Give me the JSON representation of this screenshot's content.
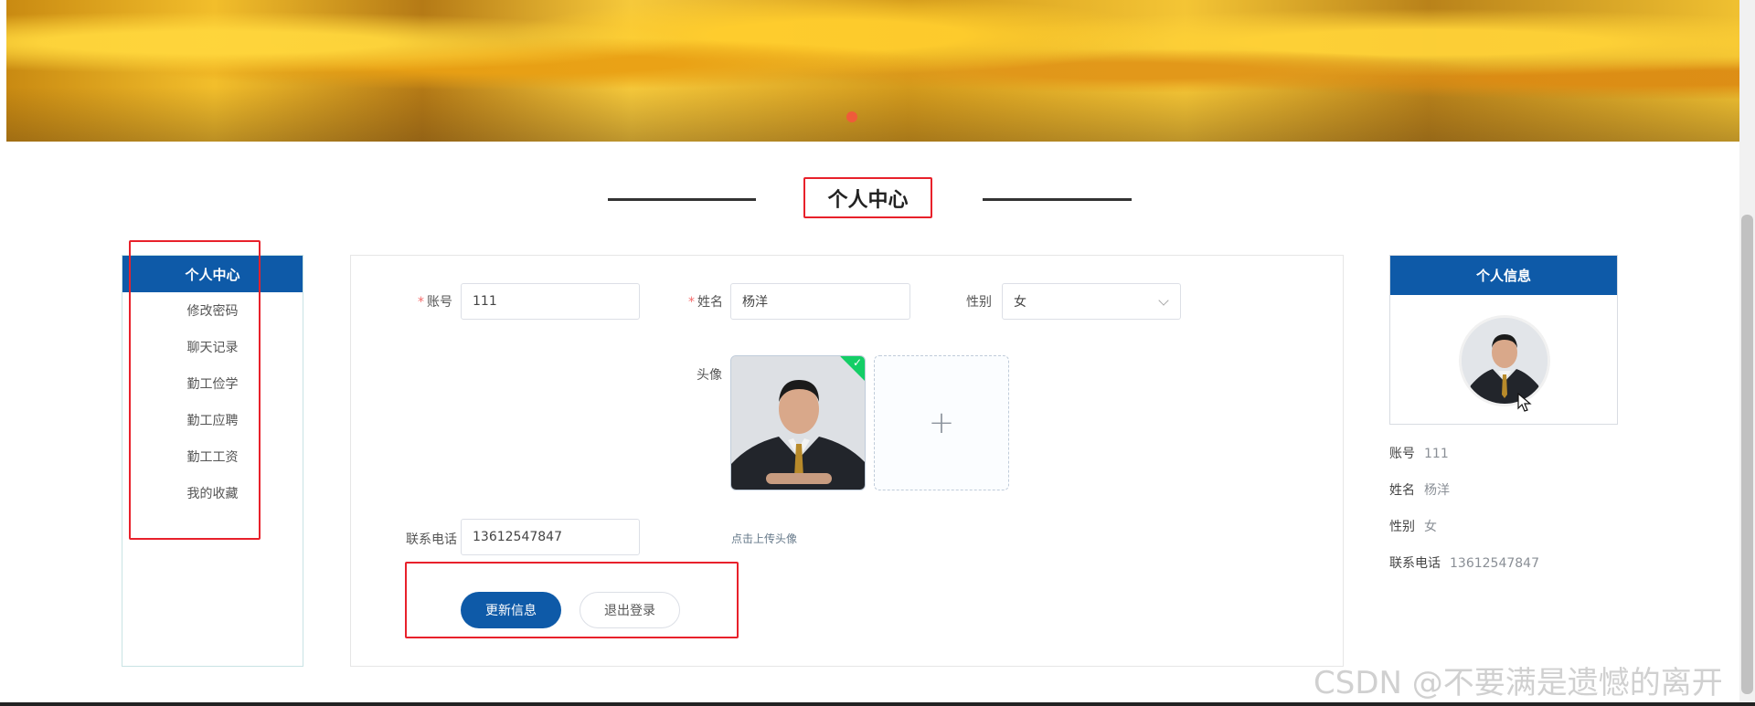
{
  "section_title": "个人中心",
  "sidebar": {
    "header": "个人中心",
    "items": [
      {
        "label": "修改密码"
      },
      {
        "label": "聊天记录"
      },
      {
        "label": "勤工俭学"
      },
      {
        "label": "勤工应聘"
      },
      {
        "label": "勤工工资"
      },
      {
        "label": "我的收藏"
      }
    ]
  },
  "form": {
    "account": {
      "label": "账号",
      "value": "111"
    },
    "name": {
      "label": "姓名",
      "value": "杨洋"
    },
    "gender": {
      "label": "性别",
      "value": "女"
    },
    "avatar": {
      "label": "头像",
      "upload_tip": "点击上传头像"
    },
    "phone": {
      "label": "联系电话",
      "value": "13612547847"
    },
    "update_button": "更新信息",
    "logout_button": "退出登录",
    "add_symbol": "+"
  },
  "info_card": {
    "header": "个人信息",
    "rows": [
      {
        "label": "账号",
        "value": "111"
      },
      {
        "label": "姓名",
        "value": "杨洋"
      },
      {
        "label": "性别",
        "value": "女"
      },
      {
        "label": "联系电话",
        "value": "13612547847"
      }
    ]
  },
  "watermark": "CSDN @不要满是遗憾的离开",
  "colors": {
    "primary": "#0e5aa8",
    "highlight": "#e8212b",
    "success": "#13ce66"
  },
  "icons": {
    "upload_check": "check-icon",
    "add": "plus-icon",
    "select": "chevron-down-icon"
  }
}
